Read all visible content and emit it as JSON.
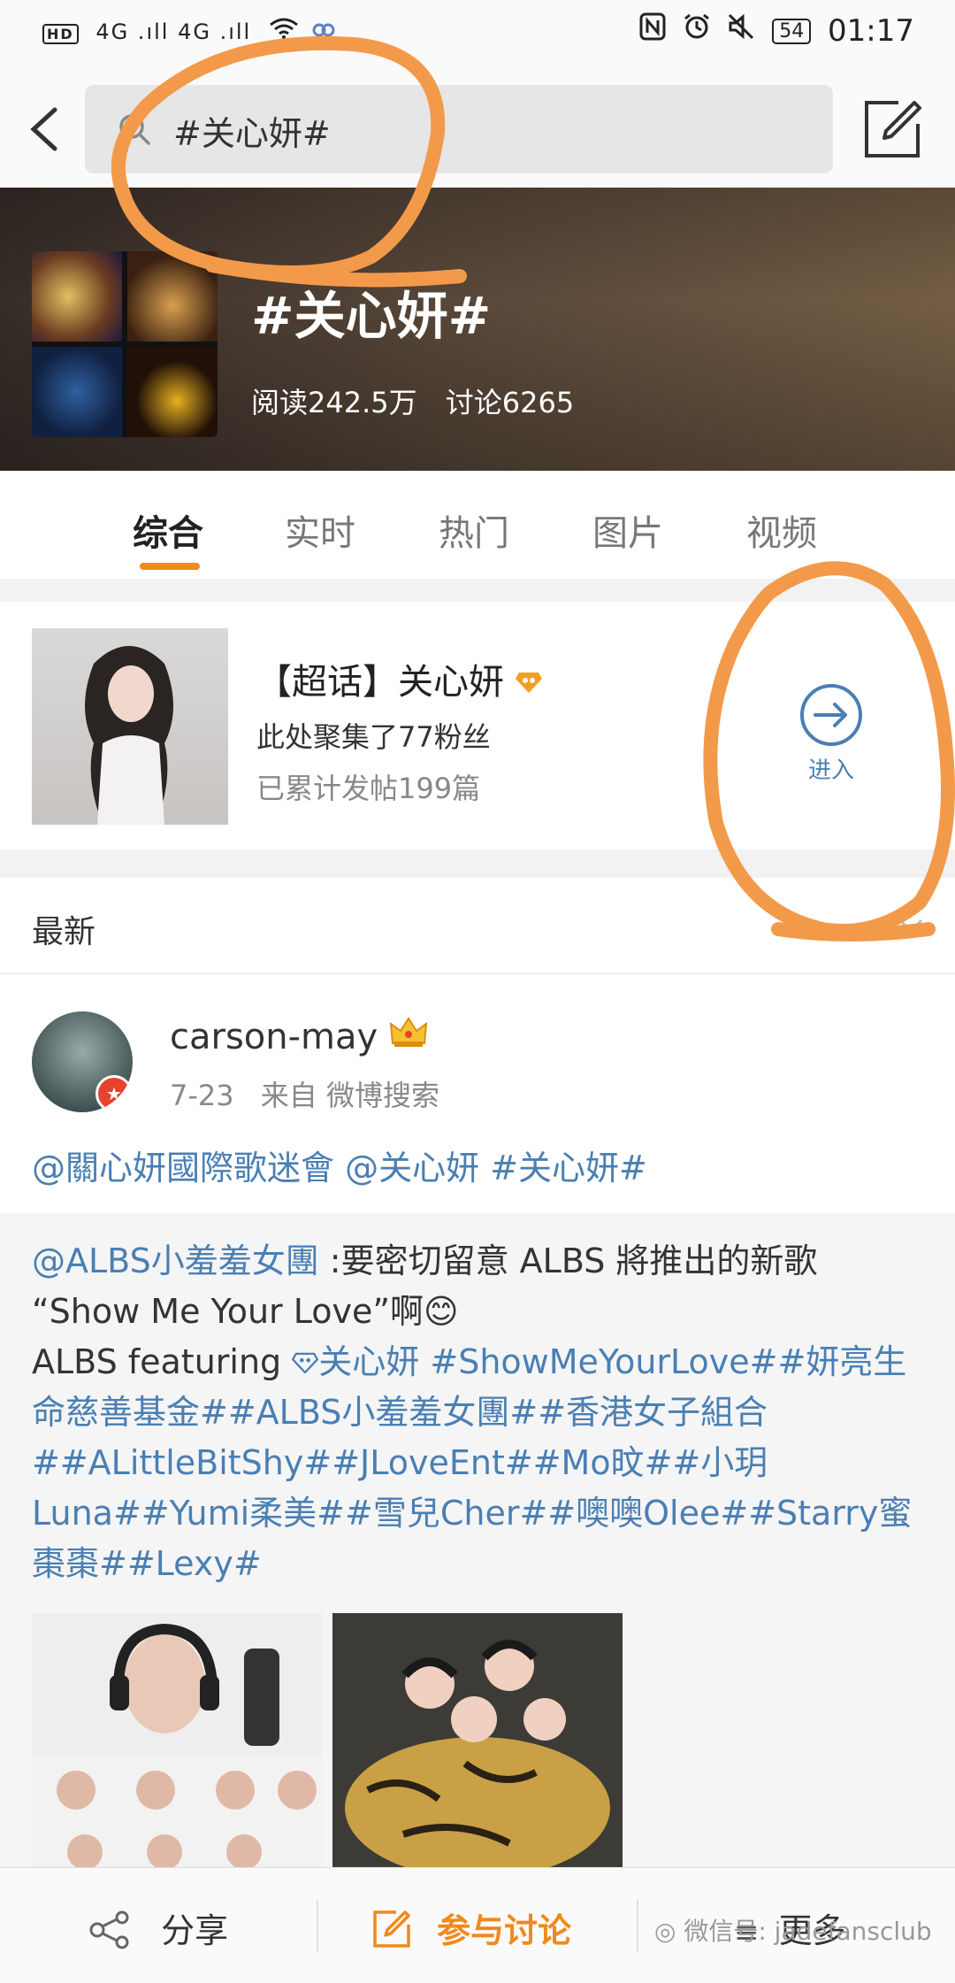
{
  "status_bar": {
    "hd": "HD",
    "network": "4G .ıll 4G .ıll",
    "battery": "54",
    "time": "01:17"
  },
  "search": {
    "query": "#关心妍#"
  },
  "topic": {
    "title": "#关心妍#",
    "reads": "阅读242.5万",
    "discussions": "讨论6265"
  },
  "tabs": [
    {
      "label": "综合"
    },
    {
      "label": "实时"
    },
    {
      "label": "热门"
    },
    {
      "label": "图片"
    },
    {
      "label": "视频"
    }
  ],
  "super_topic": {
    "title": "【超话】关心妍",
    "fans": "此处聚集了77粉丝",
    "posts": "已累计发帖199篇",
    "enter_label": "进入"
  },
  "latest": {
    "label": "最新"
  },
  "post": {
    "username": "carson-may",
    "date": "7-23",
    "source": "来自 微博搜索",
    "mentions": "@關心妍國際歌迷會 @关心妍 #关心妍#"
  },
  "repost": {
    "mention": "@ALBS小羞羞女團",
    "line1_rest": " :要密切留意 ALBS 將推出的新歌",
    "line2": "“Show Me Your Love”啊😊",
    "featuring": "ALBS featuring ",
    "featured_user": "关心妍",
    "tags": " #ShowMeYourLove##妍亮生命慈善基金##ALBS小羞羞女團##香港女子組合##ALittleBitShy##JLoveEnt##Mo旼##小玥Luna##Yumi柔美##雪兒Cher##噢噢Olee##Starry蜜棗棗##Lexy#"
  },
  "bottom_bar": {
    "share": "分享",
    "discuss": "参与讨论",
    "more": "更多"
  },
  "watermark": "微信号: jadefansclub",
  "colors": {
    "accent": "#f08a1c",
    "link": "#4a7fb3",
    "annotation": "#f39a4a"
  }
}
